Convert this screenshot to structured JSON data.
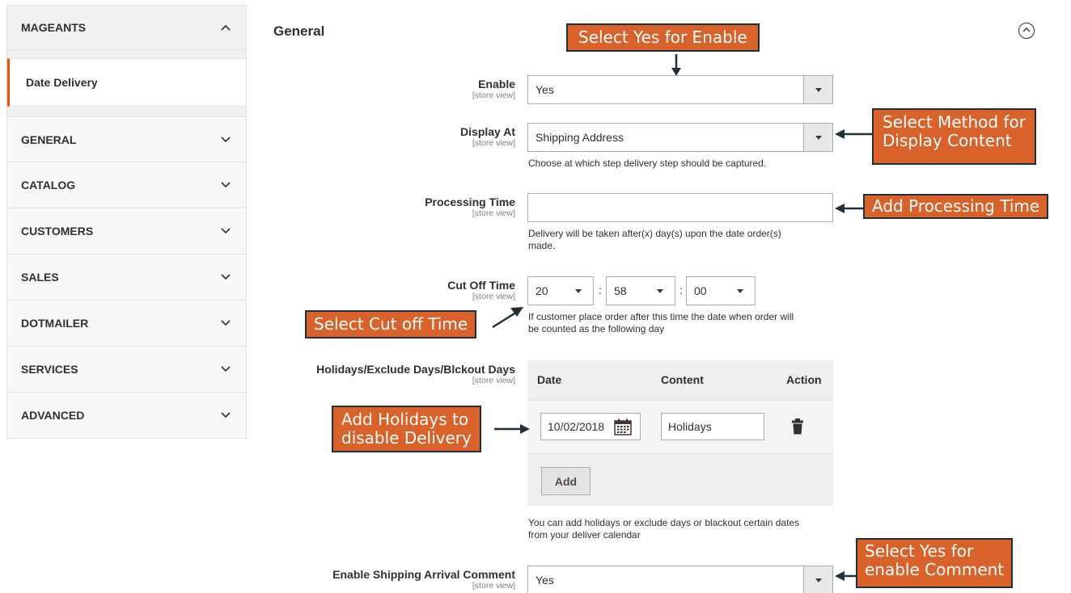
{
  "sidebar": {
    "top_section": "MAGEANTS",
    "sub_item": "Date Delivery",
    "sections": [
      "GENERAL",
      "CATALOG",
      "CUSTOMERS",
      "SALES",
      "DOTMAILER",
      "SERVICES",
      "ADVANCED"
    ]
  },
  "main": {
    "title": "General",
    "scope_label": "[store view]",
    "enable": {
      "label": "Enable",
      "value": "Yes"
    },
    "display_at": {
      "label": "Display At",
      "value": "Shipping Address",
      "note": "Choose at which step delivery step should be captured."
    },
    "processing_time": {
      "label": "Processing Time",
      "value": "",
      "note_line1": "Delivery will be taken after(x) day(s) upon the date order(s)",
      "note_line2": "made."
    },
    "cut_off_time": {
      "label": "Cut Off Time",
      "hour": "20",
      "minute": "58",
      "second": "00",
      "separator": ":",
      "note_line1": "If customer place order after this time the date when order will",
      "note_line2": "be counted as the following day"
    },
    "holidays": {
      "label": "Holidays/Exclude Days/Blckout Days",
      "columns": [
        "Date",
        "Content",
        "Action"
      ],
      "rows": [
        {
          "date": "10/02/2018",
          "content": "Holidays"
        }
      ],
      "add_label": "Add",
      "note_line1": "You can add holidays or exclude days or blackout certain dates",
      "note_line2": "from your deliver calendar"
    },
    "shipping_comment": {
      "label": "Enable Shipping Arrival Comment",
      "value": "Yes"
    }
  },
  "callouts": {
    "enable": "Select Yes for Enable",
    "display_line1": "Select Method for",
    "display_line2": "Display Content",
    "processing": "Add Processing Time",
    "cutoff": "Select Cut off Time",
    "holidays_line1": "Add Holidays to",
    "holidays_line2": "disable Delivery",
    "comment_line1": "Select Yes for",
    "comment_line2": "enable Comment"
  },
  "icons": [
    "chevron-up-icon",
    "chevron-down-icon",
    "collapse-circle-icon",
    "calendar-icon",
    "trash-icon",
    "dropdown-arrow-icon"
  ],
  "colors": {
    "accent": "#eb5202",
    "callout_bg": "#d9622b",
    "callout_border": "#20303a"
  }
}
